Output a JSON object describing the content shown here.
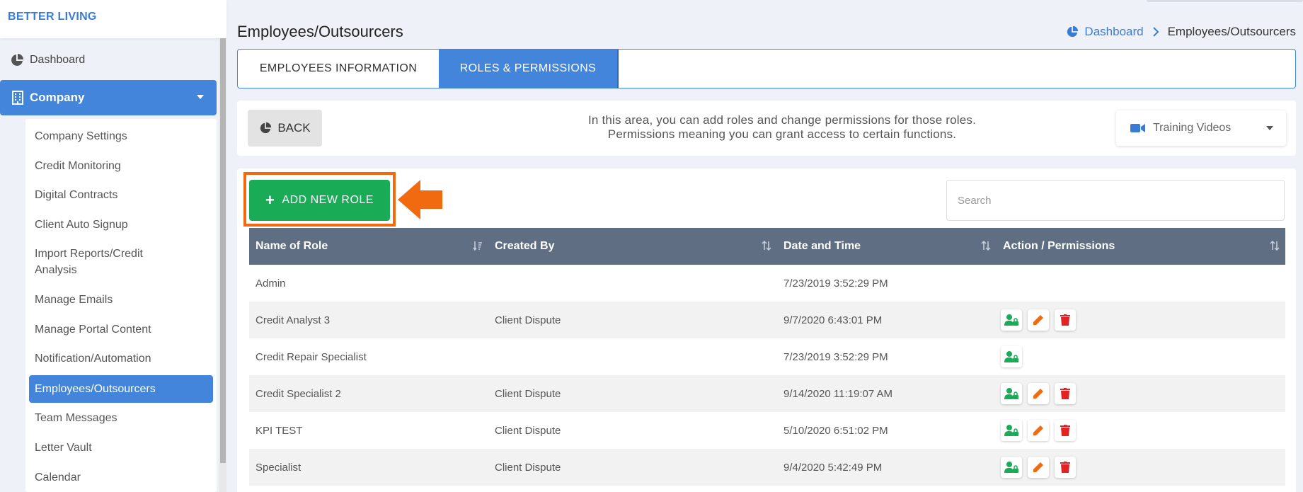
{
  "brand": "BETTER LIVING",
  "sidebar": {
    "dashboard": "Dashboard",
    "company": "Company",
    "submenu": [
      "Company Settings",
      "Credit Monitoring",
      "Digital Contracts",
      "Client Auto Signup",
      "Import Reports/Credit Analysis",
      "Manage Emails",
      "Manage Portal Content",
      "Notification/Automation",
      "Employees/Outsourcers",
      "Team Messages",
      "Letter Vault",
      "Calendar"
    ]
  },
  "header": {
    "title": "Employees/Outsourcers",
    "breadcrumb_home": "Dashboard",
    "breadcrumb_current": "Employees/Outsourcers"
  },
  "tabs": [
    "EMPLOYEES INFORMATION",
    "ROLES & PERMISSIONS"
  ],
  "info": {
    "back_label": "BACK",
    "line1": "In this area, you can add roles and change permissions for those roles.",
    "line2": "Permissions meaning you can grant access to certain functions.",
    "training_label": "Training Videos"
  },
  "toolbar": {
    "add_label": "ADD NEW ROLE",
    "search_placeholder": "Search"
  },
  "table": {
    "columns": [
      "Name of Role",
      "Created By",
      "Date and Time",
      "Action / Permissions"
    ],
    "rows": [
      {
        "name": "Admin",
        "created_by": "",
        "date": "7/23/2019 3:52:29 PM"
      },
      {
        "name": "Credit Analyst 3",
        "created_by": "Client Dispute",
        "date": "9/7/2020 6:43:01 PM"
      },
      {
        "name": "Credit Repair Specialist",
        "created_by": "",
        "date": "7/23/2019 3:52:29 PM"
      },
      {
        "name": "Credit Specialist 2",
        "created_by": "Client Dispute",
        "date": "9/14/2020 11:19:07 AM"
      },
      {
        "name": "KPI TEST",
        "created_by": "Client Dispute",
        "date": "5/10/2020 6:51:02 PM"
      },
      {
        "name": "Specialist",
        "created_by": "Client Dispute",
        "date": "9/4/2020 5:42:49 PM"
      }
    ]
  },
  "colors": {
    "accent": "#4285db",
    "add_button": "#1aab56",
    "highlight": "#f26a0f",
    "table_header": "#5f6e82",
    "permission_icon": "#1aab56",
    "edit_icon": "#f26a0f",
    "delete_icon": "#e02424"
  }
}
